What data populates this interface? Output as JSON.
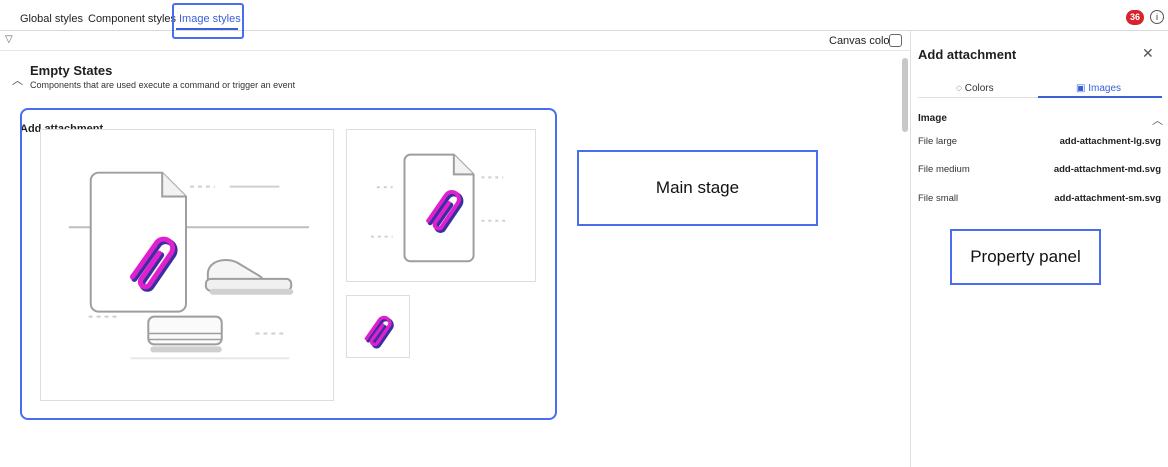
{
  "tabs": [
    {
      "label": "Global styles"
    },
    {
      "label": "Component styles"
    },
    {
      "label": "Image styles"
    }
  ],
  "header": {
    "badge_count": "36",
    "info_icon": "info-icon"
  },
  "stage": {
    "canvas_color_label": "Canvas color",
    "section_title": "Empty States",
    "section_description": "Components that are used execute a command or trigger an event",
    "group_title": "Add attachment",
    "callout_label": "Main stage"
  },
  "panel": {
    "title": "Add attachment",
    "tabs": [
      {
        "label": "Colors",
        "icon": "palette-icon"
      },
      {
        "label": "Images",
        "icon": "image-icon"
      }
    ],
    "section_label": "Image",
    "properties": [
      {
        "key": "File large",
        "value": "add-attachment-lg.svg"
      },
      {
        "key": "File medium",
        "value": "add-attachment-md.svg"
      },
      {
        "key": "File small",
        "value": "add-attachment-sm.svg"
      }
    ],
    "callout_label": "Property panel"
  },
  "colors": {
    "accent": "#3b5fd9",
    "highlight_border": "#4a6cf0",
    "badge": "#d6232d",
    "clip_magenta": "#e01fcf",
    "clip_shadow": "#3a2fa0"
  }
}
